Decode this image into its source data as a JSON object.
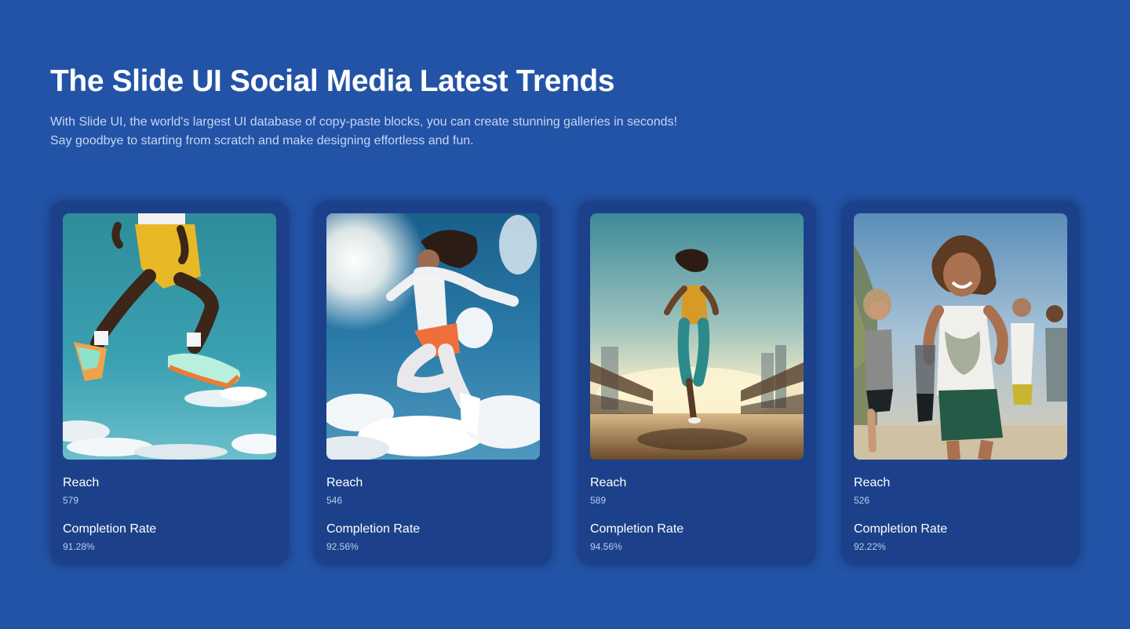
{
  "header": {
    "title": "The Slide UI Social Media Latest Trends",
    "subtitle": "With Slide UI, the world's largest UI database of copy-paste blocks, you can create stunning galleries in seconds! Say goodbye to starting from scratch and make designing effortless and fun."
  },
  "cards": [
    {
      "image": "athlete-jumping-photo",
      "reach_label": "Reach",
      "reach": "579",
      "completion_label": "Completion Rate",
      "completion": "91.28%"
    },
    {
      "image": "woman-leaping-sky-photo",
      "reach_label": "Reach",
      "reach": "546",
      "completion_label": "Completion Rate",
      "completion": "92.56%"
    },
    {
      "image": "runner-on-bridge-photo",
      "reach_label": "Reach",
      "reach": "589",
      "completion_label": "Completion Rate",
      "completion": "94.56%"
    },
    {
      "image": "group-running-photo",
      "reach_label": "Reach",
      "reach": "526",
      "completion_label": "Completion Rate",
      "completion": "92.22%"
    }
  ],
  "colors": {
    "background": "#2353a6",
    "card": "#1c418a",
    "label": "#ffffff",
    "value": "#b8cdef"
  }
}
